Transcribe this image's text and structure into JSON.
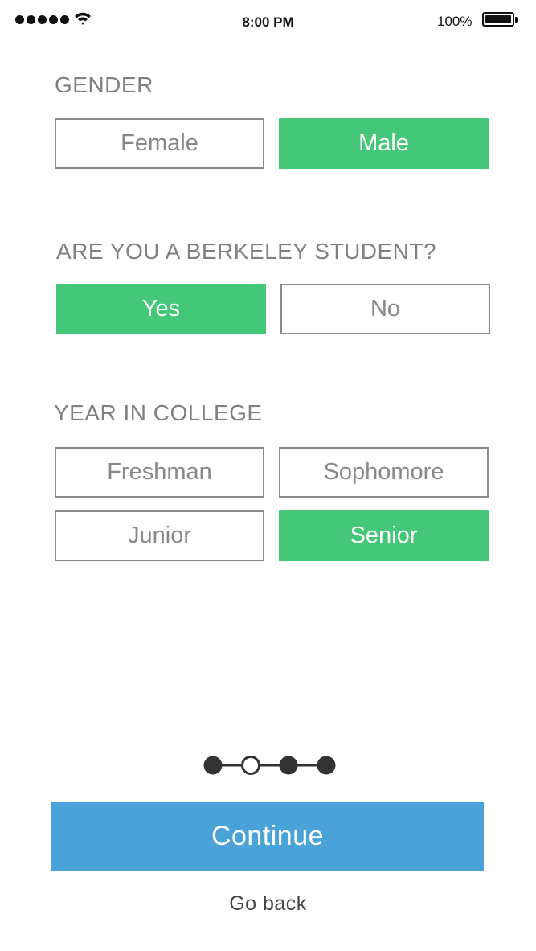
{
  "status_bar": {
    "time": "8:00 PM",
    "battery_percent": "100%",
    "signal_bars": 5,
    "icons": [
      "signal-icon",
      "wifi-icon",
      "battery-icon"
    ]
  },
  "colors": {
    "selected": "#45c77a",
    "primary": "#4aa3d8",
    "heading": "#808080"
  },
  "gender": {
    "heading": "GENDER",
    "options": [
      "Female",
      "Male"
    ],
    "selected": "Male"
  },
  "berkeley": {
    "heading": "ARE YOU A BERKELEY STUDENT?",
    "options": [
      "Yes",
      "No"
    ],
    "selected": "Yes"
  },
  "year": {
    "heading": "YEAR IN COLLEGE",
    "options": [
      "Freshman",
      "Sophomore",
      "Junior",
      "Senior"
    ],
    "selected": "Senior"
  },
  "progress": {
    "total_steps": 4,
    "current_step": 2
  },
  "actions": {
    "continue_label": "Continue",
    "back_label": "Go back"
  }
}
